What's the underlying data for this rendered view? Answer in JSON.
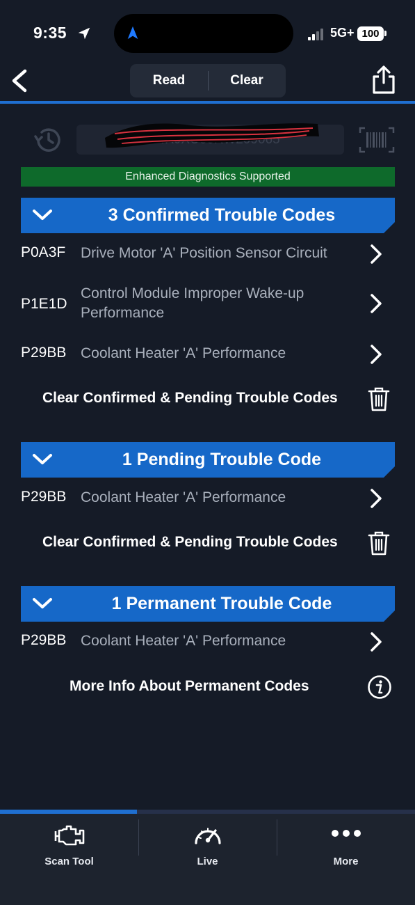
{
  "status_bar": {
    "time": "9:35",
    "network": "5G+",
    "battery": "100"
  },
  "nav": {
    "read_label": "Read",
    "clear_label": "Clear"
  },
  "vin": {
    "value": "1C4RJXU60RW209065"
  },
  "banner": {
    "enhanced": "Enhanced Diagnostics Supported"
  },
  "confirmed": {
    "title": "3 Confirmed Trouble Codes",
    "codes": [
      {
        "code": "P0A3F",
        "description": "Drive Motor 'A' Position Sensor Circuit"
      },
      {
        "code": "P1E1D",
        "description": "Control Module Improper Wake-up Performance"
      },
      {
        "code": "P29BB",
        "description": "Coolant Heater 'A' Performance"
      }
    ],
    "action_label": "Clear Confirmed & Pending Trouble Codes"
  },
  "pending": {
    "title": "1 Pending Trouble Code",
    "codes": [
      {
        "code": "P29BB",
        "description": "Coolant Heater 'A' Performance"
      }
    ],
    "action_label": "Clear Confirmed & Pending Trouble Codes"
  },
  "permanent": {
    "title": "1 Permanent Trouble Code",
    "codes": [
      {
        "code": "P29BB",
        "description": "Coolant Heater 'A' Performance"
      }
    ],
    "action_label": "More Info About Permanent Codes"
  },
  "tabs": [
    {
      "label": "Scan Tool",
      "icon": "engine-icon"
    },
    {
      "label": "Live",
      "icon": "gauge-icon"
    },
    {
      "label": "More",
      "icon": "more-dots-icon"
    }
  ],
  "tab_progress": 0.33,
  "colors": {
    "accent": "#1668c8",
    "banner_green": "#0e6a2b",
    "background": "#151b27"
  }
}
